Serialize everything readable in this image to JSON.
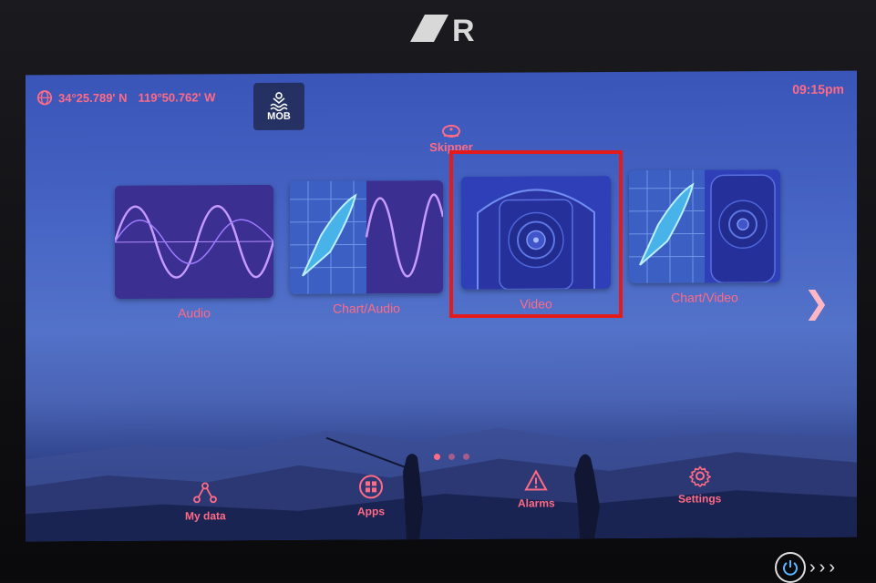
{
  "status": {
    "latitude": "34°25.789' N",
    "longitude": "119°50.762' W",
    "time": "09:15pm"
  },
  "mob": {
    "label": "MOB"
  },
  "profile": {
    "label": "Skipper"
  },
  "tiles": [
    {
      "label": "Audio"
    },
    {
      "label": "Chart/Audio"
    },
    {
      "label": "Video"
    },
    {
      "label": "Chart/Video"
    }
  ],
  "pagination": {
    "pages": 3,
    "current": 1
  },
  "bottom_nav": {
    "my_data": "My data",
    "apps": "Apps",
    "alarms": "Alarms",
    "settings": "Settings"
  },
  "colors": {
    "accent": "#ff6b86",
    "highlight": "#e31b1b"
  },
  "icons": [
    "globe-icon",
    "mob-icon",
    "skipper-icon",
    "next-page-icon",
    "my-data-icon",
    "apps-icon",
    "alarms-icon",
    "settings-icon",
    "power-icon"
  ]
}
